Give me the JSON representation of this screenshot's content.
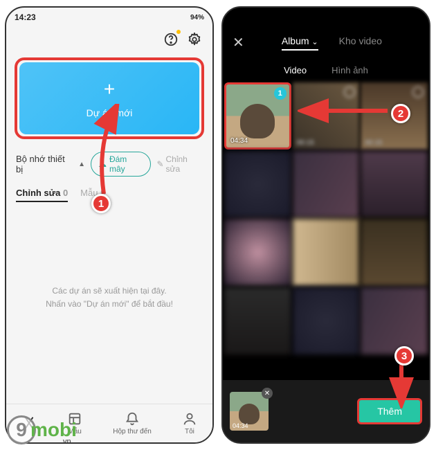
{
  "left": {
    "status": {
      "time": "14:23",
      "battery": "94%",
      "icons": "▾ ⋮ VoLTE ▲◢◢▮"
    },
    "newProject": "Dự án mới",
    "storage": "Bộ nhớ thiết bị",
    "cloud": "Đám mây",
    "edit": "Chỉnh sửa",
    "tabs": {
      "edit": "Chỉnh sửa",
      "editCount": "0",
      "template": "Mẫu",
      "templateCount": "0"
    },
    "empty1": "Các dự án sẽ xuất hiện tại đây.",
    "empty2": "Nhấn vào \"Dự án mới\" để bắt đầu!",
    "nav": {
      "cut": "",
      "template": "Mẫu",
      "inbox": "Hộp thư đến",
      "me": "Tôi"
    }
  },
  "right": {
    "tabs": {
      "album": "Album",
      "chevron": "⌄",
      "stock": "Kho video"
    },
    "media": {
      "video": "Video",
      "image": "Hình ảnh"
    },
    "selectedBadge": "1",
    "durations": {
      "c1": "04:34",
      "c2": "00:15",
      "c3": "00:15"
    },
    "trayDur": "04:34",
    "add": "Thêm"
  },
  "markers": {
    "m1": "1",
    "m2": "2",
    "m3": "3"
  },
  "watermark": {
    "nine": "9",
    "text": "mobi",
    "sub": ".vn"
  }
}
